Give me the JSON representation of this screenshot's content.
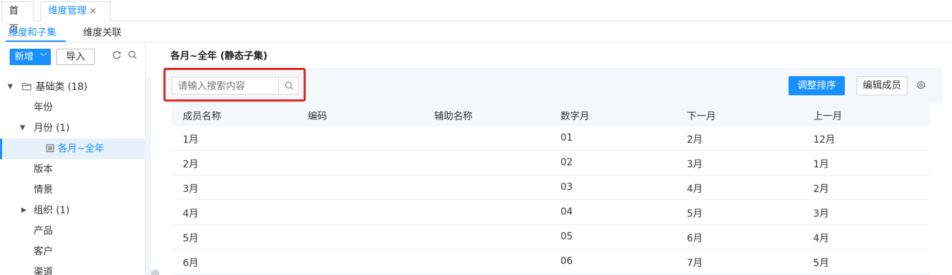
{
  "page_tabs": [
    {
      "label": "首页"
    },
    {
      "label": "维度管理",
      "close": "×"
    }
  ],
  "sub_tabs": [
    {
      "label": "维度和子集"
    },
    {
      "label": "维度关联"
    }
  ],
  "sidebar": {
    "new_label": "新增",
    "import_label": "导入",
    "tree": [
      {
        "label": "基础类 (18)"
      },
      {
        "label": "年份"
      },
      {
        "label": "月份 (1)"
      },
      {
        "label": "各月~全年"
      },
      {
        "label": "版本"
      },
      {
        "label": "情景"
      },
      {
        "label": "组织 (1)"
      },
      {
        "label": "产品"
      },
      {
        "label": "客户"
      },
      {
        "label": "渠道"
      }
    ]
  },
  "main": {
    "title": "各月~全年 (静态子集)",
    "search_placeholder": "请输入搜索内容",
    "sort_button": "调整排序",
    "edit_button": "编辑成员"
  },
  "table": {
    "columns": [
      "成员名称",
      "编码",
      "辅助名称",
      "数字月",
      "下一月",
      "上一月"
    ],
    "rows": [
      [
        "1月",
        "",
        "",
        "01",
        "2月",
        "12月"
      ],
      [
        "2月",
        "",
        "",
        "02",
        "3月",
        "1月"
      ],
      [
        "3月",
        "",
        "",
        "03",
        "4月",
        "2月"
      ],
      [
        "4月",
        "",
        "",
        "04",
        "5月",
        "3月"
      ],
      [
        "5月",
        "",
        "",
        "05",
        "6月",
        "4月"
      ],
      [
        "6月",
        "",
        "",
        "06",
        "7月",
        "5月"
      ]
    ]
  },
  "colors": {
    "accent": "#1890ff",
    "highlight_box": "#e0201b"
  }
}
